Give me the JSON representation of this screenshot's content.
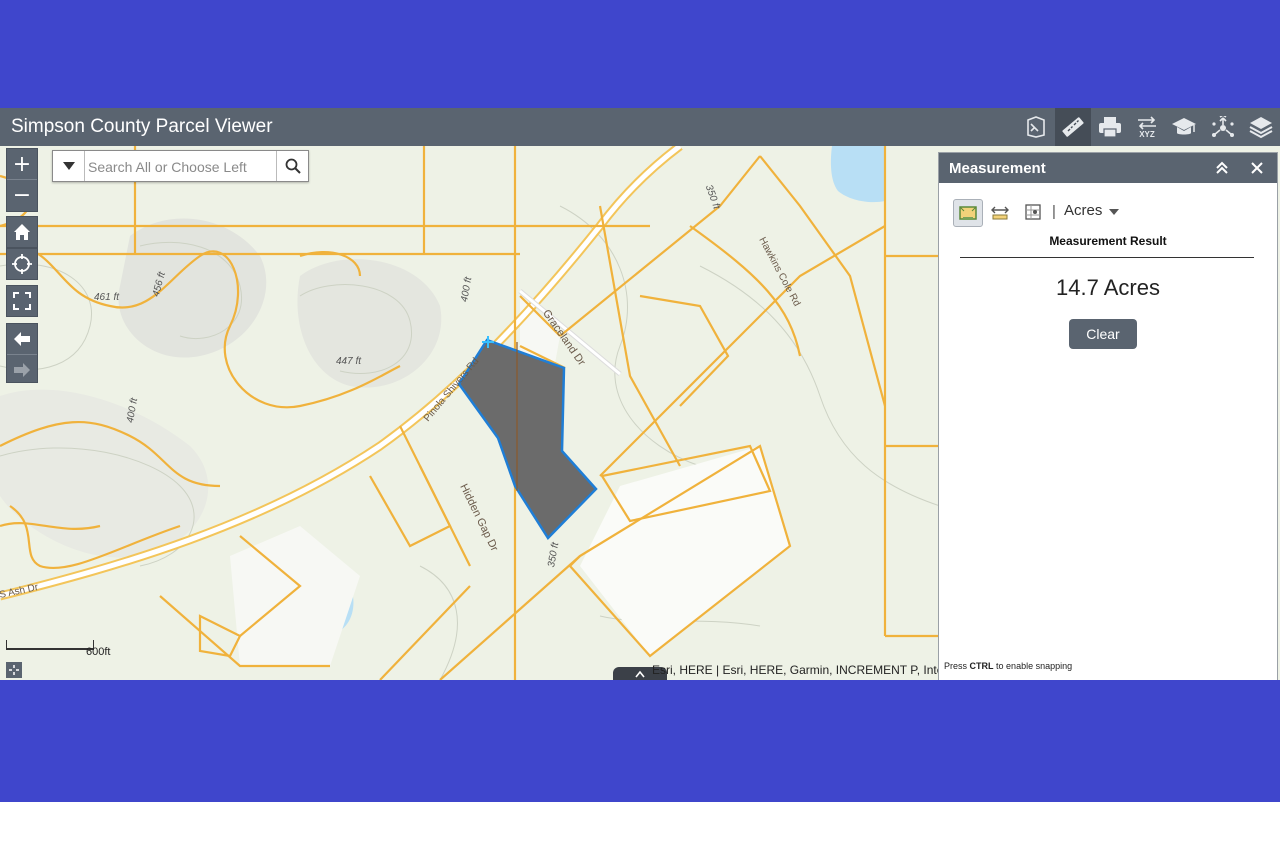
{
  "app": {
    "title": "Simpson County Parcel Viewer"
  },
  "header_tools": [
    {
      "name": "identify-tool",
      "icon": "identify-icon"
    },
    {
      "name": "measurement-tool",
      "icon": "ruler-icon",
      "active": true
    },
    {
      "name": "print-tool",
      "icon": "printer-icon"
    },
    {
      "name": "xyz-tool",
      "icon": "xyz-icon"
    },
    {
      "name": "about-tool",
      "icon": "graduation-cap-icon"
    },
    {
      "name": "share-tool",
      "icon": "share-icon"
    },
    {
      "name": "layers-tool",
      "icon": "layers-icon"
    }
  ],
  "header_labels": {
    "xyz": "XYZ"
  },
  "map_controls": {
    "zoom_in": "+",
    "zoom_out": "−"
  },
  "search": {
    "placeholder": "Search All or Choose Left"
  },
  "map": {
    "labels": {
      "contour_461": "461 ft",
      "contour_456": "456 ft",
      "contour_447": "447 ft",
      "contour_400a": "400 ft",
      "contour_400b": "400 ft",
      "contour_350a": "350 ft",
      "contour_350b": "350 ft",
      "road_graceland": "Graceland Dr",
      "road_hawkins": "Hawkins Cole Rd",
      "road_hidden_gap": "Hidden Gap Dr",
      "road_pinola": "Pinola Shivers Rd",
      "road_s_ash": "S Ash Dr"
    },
    "scale_label": "600ft",
    "attribution": "Esri, HERE | Esri, HERE, Garmin, INCREMENT P, Inter",
    "colors": {
      "parcel_line": "#f0b23c",
      "selected_fill": "#6b6b6b",
      "selected_outline": "#1f7ed6",
      "water": "#b8dff5"
    }
  },
  "measurement_panel": {
    "title": "Measurement",
    "unit": "Acres",
    "unit_separator": "|",
    "result_heading": "Measurement Result",
    "result_value": "14.7 Acres",
    "clear_label": "Clear",
    "snap_hint_prefix": "Press",
    "snap_hint_key": "CTRL",
    "snap_hint_suffix": "to enable snapping"
  }
}
